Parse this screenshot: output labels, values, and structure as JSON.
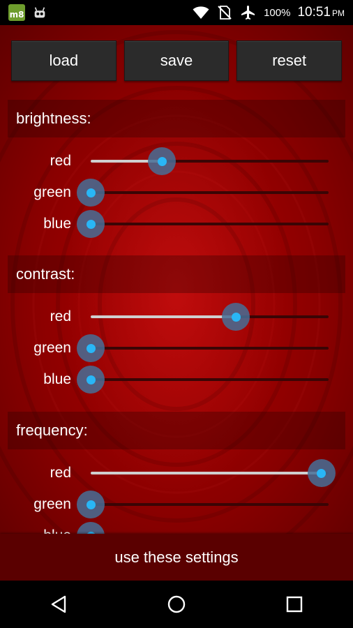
{
  "status_bar": {
    "app_badge": "m8",
    "battery_percent": "100%",
    "time": "10:51",
    "ampm": "PM",
    "icons": [
      "m8-app-icon",
      "android-robot-icon",
      "wifi-icon",
      "no-sim-icon",
      "airplane-mode-icon"
    ]
  },
  "buttons": {
    "load": "load",
    "save": "save",
    "reset": "reset"
  },
  "sections": [
    {
      "title": "brightness:",
      "sliders": [
        {
          "label": "red",
          "value": 0.3
        },
        {
          "label": "green",
          "value": 0.0
        },
        {
          "label": "blue",
          "value": 0.0
        }
      ]
    },
    {
      "title": "contrast:",
      "sliders": [
        {
          "label": "red",
          "value": 0.61
        },
        {
          "label": "green",
          "value": 0.0
        },
        {
          "label": "blue",
          "value": 0.0
        }
      ]
    },
    {
      "title": "frequency:",
      "sliders": [
        {
          "label": "red",
          "value": 0.97
        },
        {
          "label": "green",
          "value": 0.0
        },
        {
          "label": "blue",
          "value": 0.0
        }
      ]
    }
  ],
  "action": {
    "label": "use these settings"
  },
  "colors": {
    "accent": "#29b6f6",
    "panel_red": "#9a0000",
    "button_bg": "#2b2b2b"
  }
}
